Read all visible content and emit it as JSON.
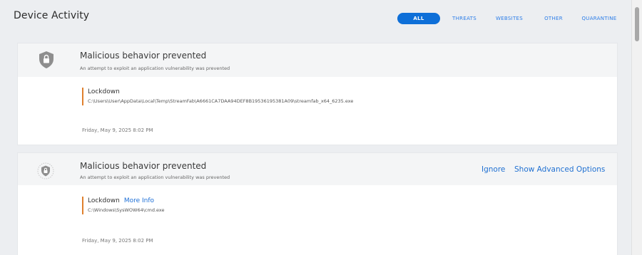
{
  "header": {
    "title": "Device Activity",
    "filters": [
      "ALL",
      "THREATS",
      "WEBSITES",
      "OTHER",
      "QUARANTINE"
    ],
    "active_filter": "ALL"
  },
  "events": [
    {
      "title": "Malicious behavior prevented",
      "subtitle": "An attempt to exploit an application vulnerability was prevented",
      "type": "Lockdown",
      "path": "C:\\Users\\User\\AppData\\Local\\Temp\\StreamFab\\A6661CA7DAA94DEF8B19536195381A09\\streamfab_x64_6235.exe",
      "timestamp": "Friday, May 9, 2025 8:02 PM"
    },
    {
      "title": "Malicious behavior prevented",
      "subtitle": "An attempt to exploit an application vulnerability was prevented",
      "type": "Lockdown",
      "more_info": "More Info",
      "path": "C:\\Windows\\SysWOW64\\cmd.exe",
      "timestamp": "Friday, May 9, 2025 8:02 PM",
      "actions": {
        "ignore": "Ignore",
        "advanced": "Show Advanced Options"
      }
    }
  ],
  "colors": {
    "accent": "#0e6fd8",
    "link": "#2171d2",
    "warning_bar": "#e0802d",
    "background": "#eceef1"
  }
}
